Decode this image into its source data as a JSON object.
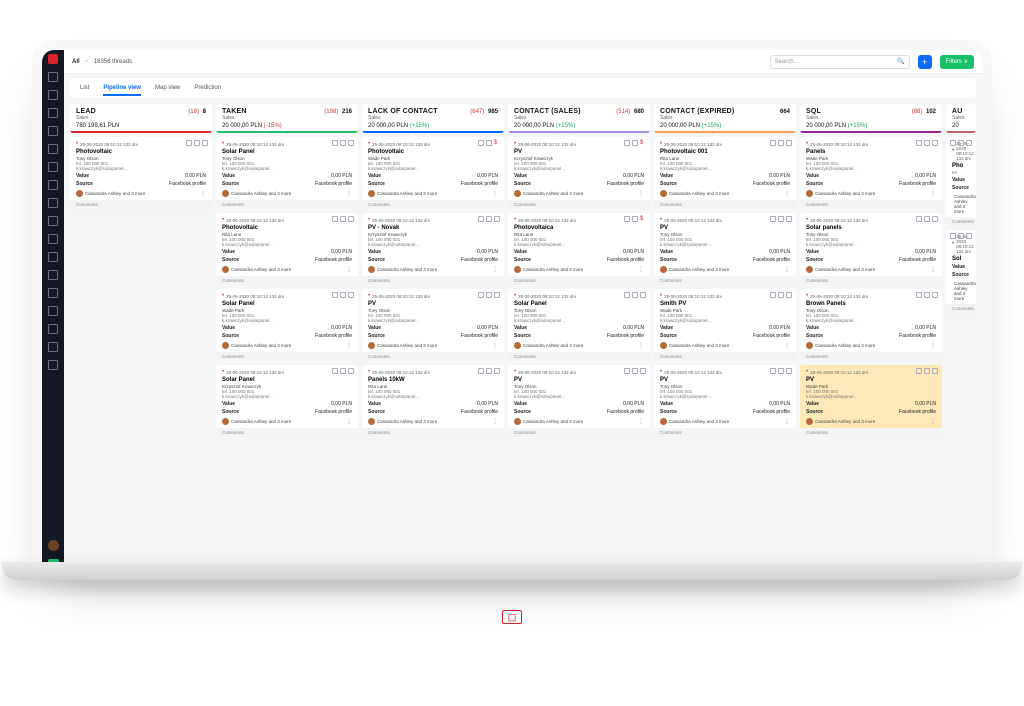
{
  "header": {
    "breadcrumb_all": "All",
    "thread_count": "18356 threads",
    "search_placeholder": "Search...",
    "filters_label": "Filters ∨"
  },
  "tabs": {
    "list": "List",
    "pipeline": "Pipeline view",
    "map": "Map view",
    "prediction": "Prediction"
  },
  "columns": [
    {
      "name": "LEAD",
      "stripe": "#d9242b",
      "pre_count": "(18)",
      "count": "8",
      "subtitle": "Sales",
      "amount": "780 199,61 PLN",
      "pct": "",
      "cards": [
        {
          "title": "Photovoltaic",
          "person": "Tony Olson",
          "tel": "tel. 100 000 001",
          "email": "k.krawczyk@solarpanel...",
          "value": "0,00 PLN",
          "source": "Facebook profile"
        }
      ]
    },
    {
      "name": "TAKEN",
      "stripe": "#19c06a",
      "pre_count": "(198)",
      "count": "216",
      "subtitle": "Sales",
      "amount": "20 000,00 PLN",
      "pct": "(-15%)",
      "pct_neg": true,
      "cards": [
        {
          "title": "Solar Panel",
          "person": "Tony Olson",
          "tel": "tel. 100 000 001",
          "email": "k.krawczyk@solarpanel...",
          "value": "0,00 PLN",
          "source": "Facebook profile"
        },
        {
          "title": "Photovoltaic",
          "person": "Rita Lane",
          "tel": "tel. 100 000 001",
          "email": "k.krawczyk@solarpanel...",
          "value": "0,00 PLN",
          "source": "Facebook profile"
        },
        {
          "title": "Solar Panel",
          "person": "Wade Park",
          "tel": "tel. 100 000 001",
          "email": "k.krawczyk@solarpanel...",
          "value": "0,00 PLN",
          "source": "Facebook profile"
        },
        {
          "title": "Solar Panel",
          "person": "Krzysztof Krawczyk",
          "tel": "tel. 100 000 001",
          "email": "k.krawczyk@solarpanel...",
          "value": "0,00 PLN",
          "source": "Facebook profile"
        }
      ]
    },
    {
      "name": "LACK OF CONTACT",
      "stripe": "#0b6bff",
      "pre_count": "(647)",
      "count": "985",
      "subtitle": "Sales",
      "amount": "20 000,00 PLN",
      "pct": "(+15%)",
      "cards": [
        {
          "title": "Photovoltaic",
          "person": "Wade Park",
          "tel": "tel. 100 000 001",
          "email": "k.krawczyk@solarpanel...",
          "value": "0,00 PLN",
          "source": "Facebook profile",
          "dollar": true
        },
        {
          "title": "PV - Novak",
          "person": "Krzysztof Krawczyk",
          "tel": "tel. 100 000 001",
          "email": "k.krawczyk@solarpanel...",
          "value": "0,00 PLN",
          "source": "Facebook profile"
        },
        {
          "title": "PV",
          "person": "Tony Olson",
          "tel": "tel. 100 000 001",
          "email": "k.krawczyk@solarpanel...",
          "value": "0,00 PLN",
          "source": "Facebook profile"
        },
        {
          "title": "Panels 10kW",
          "person": "Rita Lane",
          "tel": "tel. 100 000 001",
          "email": "k.krawczyk@solarpanel...",
          "value": "0,00 PLN",
          "source": "Facebook profile"
        }
      ]
    },
    {
      "name": "CONTACT (SALES)",
      "stripe": "#a58af0",
      "pre_count": "(514)",
      "count": "680",
      "subtitle": "Sales",
      "amount": "20 000,00 PLN",
      "pct": "(+15%)",
      "cards": [
        {
          "title": "PV",
          "person": "Krzysztof Krawczyk",
          "tel": "tel. 100 000 001",
          "email": "k.krawczyk@solarpanel...",
          "value": "0,00 PLN",
          "source": "Facebook profile",
          "dollar": true
        },
        {
          "title": "Photovoltaica",
          "person": "Rita Lane",
          "tel": "tel. 100 000 001",
          "email": "k.krawczyk@solarpanel...",
          "value": "0,00 PLN",
          "source": "Facebook profile",
          "dollar": true
        },
        {
          "title": "Solar Panel",
          "person": "Tony Olson",
          "tel": "tel. 100 000 001",
          "email": "k.krawczyk@solarpanel...",
          "value": "0,00 PLN",
          "source": "Facebook profile"
        },
        {
          "title": "PV",
          "person": "Tony Olson",
          "tel": "tel. 100 000 001",
          "email": "k.krawczyk@solarpanel...",
          "value": "0,00 PLN",
          "source": "Facebook profile"
        }
      ]
    },
    {
      "name": "CONTACT (EXPIRED)",
      "stripe": "#f0a05c",
      "pre_count": "",
      "count": "664",
      "subtitle": "Sales",
      "amount": "20 000,00 PLN",
      "pct": "(+15%)",
      "cards": [
        {
          "title": "Photovoltaic 001",
          "person": "Rita Lane",
          "tel": "tel. 100 000 001",
          "email": "k.krawczyk@solarpanel...",
          "value": "0,00 PLN",
          "source": "Facebook profile"
        },
        {
          "title": "PV",
          "person": "Tony Olson",
          "tel": "tel. 100 000 001",
          "email": "k.krawczyk@solarpanel...",
          "value": "0,00 PLN",
          "source": "Facebook profile"
        },
        {
          "title": "Smith PV",
          "person": "Wade Park",
          "tel": "tel. 100 000 001",
          "email": "k.krawczyk@solarpanel...",
          "value": "0,00 PLN",
          "source": "Facebook profile"
        },
        {
          "title": "PV",
          "person": "Tony Olson",
          "tel": "tel. 100 000 001",
          "email": "k.krawczyk@solarpanel...",
          "value": "0,00 PLN",
          "source": "Facebook profile"
        }
      ]
    },
    {
      "name": "SQL",
      "stripe": "#8f2a8b",
      "pre_count": "(88)",
      "count": "102",
      "subtitle": "Sales",
      "amount": "20 000,00 PLN",
      "pct": "(+15%)",
      "cards": [
        {
          "title": "Panels",
          "person": "Wade Park",
          "tel": "tel. 100 000 001",
          "email": "k.krawczyk@solarpanel...",
          "value": "0,00 PLN",
          "source": "Facebook profile"
        },
        {
          "title": "Solar panels",
          "person": "Tony Olson",
          "tel": "tel. 100 000 001",
          "email": "k.krawczyk@solarpanel...",
          "value": "0,00 PLN",
          "source": "Facebook profile"
        },
        {
          "title": "Brown Panels",
          "person": "Tony Olson",
          "tel": "tel. 100 000 001",
          "email": "k.krawczyk@solarpanel...",
          "value": "0,00 PLN",
          "source": "Facebook profile"
        },
        {
          "title": "PV",
          "person": "Wade Park",
          "tel": "tel. 100 000 001",
          "email": "k.krawczyk@solarpanel...",
          "value": "0,00 PLN",
          "source": "Facebook profile",
          "highlight": true
        }
      ]
    },
    {
      "name": "AU",
      "stripe": "#b9646e",
      "pre_count": "",
      "count": "",
      "subtitle": "Sales",
      "amount": "20",
      "pct": "",
      "cards": [
        {
          "title": "Pho",
          "person": "",
          "tel": "tel",
          "email": "",
          "value": "",
          "source": ""
        },
        {
          "title": "Sol",
          "person": "",
          "tel": "",
          "email": "",
          "value": "",
          "source": ""
        }
      ]
    }
  ],
  "card_meta": {
    "date": "25-06-2020  08:10:12  132 dni",
    "value_label": "Value",
    "source_label": "Source",
    "assignees": "Cassandra Ashley and 3 more",
    "comments": "Comments"
  }
}
